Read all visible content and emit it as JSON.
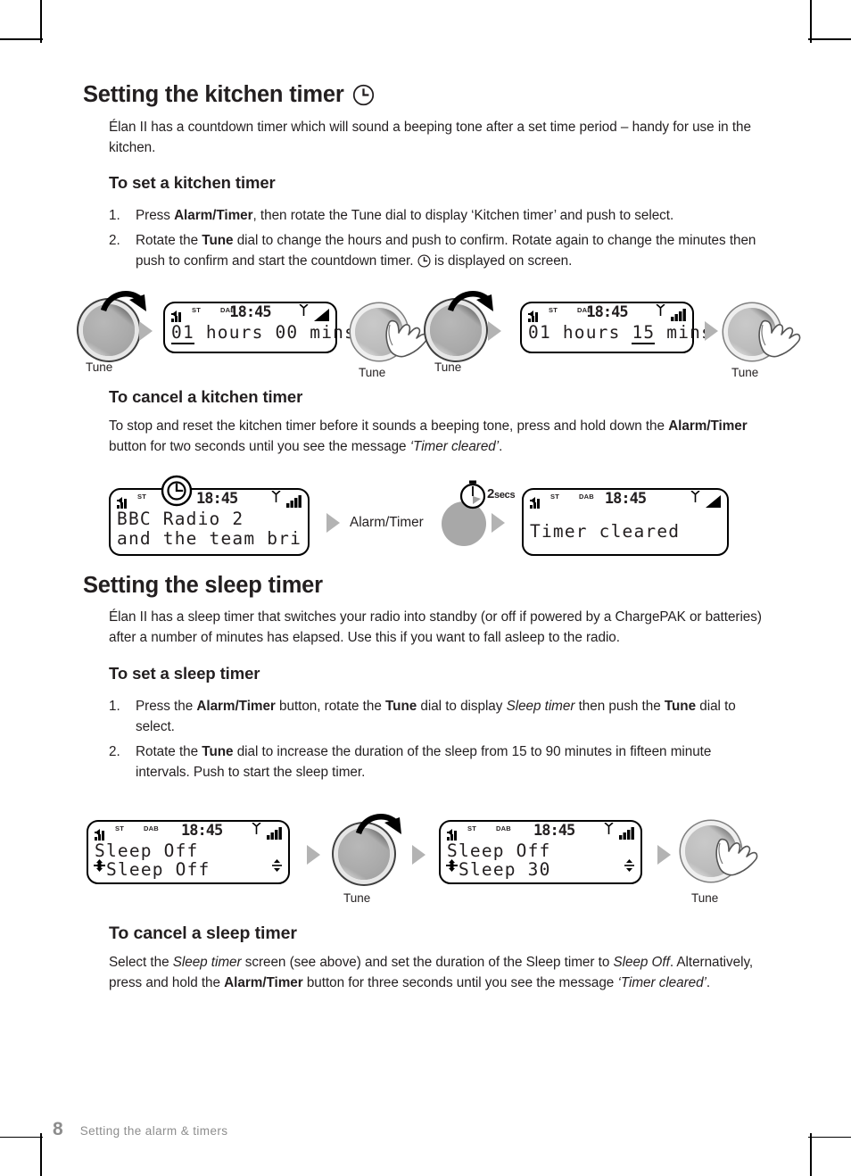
{
  "page": {
    "number": "8",
    "footer_title": "Setting the alarm & timers"
  },
  "sections": [
    {
      "id": "kitchen-timer",
      "heading": "Setting the kitchen timer",
      "heading_icon": "clock-icon",
      "intro": "Élan II has a countdown timer which will sound a beeping tone after a set time period – handy for use in the kitchen.",
      "sub_heading_set": "To set a kitchen timer",
      "steps": [
        {
          "num": "1.",
          "parts": [
            {
              "t": "Press ",
              "s": "n"
            },
            {
              "t": "Alarm/Timer",
              "s": "b"
            },
            {
              "t": ", then rotate the Tune dial to display ‘Kitchen timer’ and push to select.",
              "s": "n"
            }
          ]
        },
        {
          "num": "2.",
          "parts": [
            {
              "t": "Rotate the ",
              "s": "n"
            },
            {
              "t": "Tune",
              "s": "b"
            },
            {
              "t": " dial to change the hours and push to confirm. Rotate again to change the minutes then push to confirm and start the countdown timer. ",
              "s": "n"
            },
            {
              "t": "[clock]",
              "s": "icon"
            },
            {
              "t": " is displayed on screen.",
              "s": "n"
            }
          ]
        }
      ],
      "sub_heading_cancel": "To cancel a kitchen timer",
      "cancel_parts": [
        {
          "t": "To stop and reset the kitchen timer before it sounds a beeping tone, press and hold down the ",
          "s": "n"
        },
        {
          "t": "Alarm/Timer",
          "s": "b"
        },
        {
          "t": " button for two seconds until you see the message ",
          "s": "n"
        },
        {
          "t": "‘Timer cleared’",
          "s": "i"
        },
        {
          "t": ".",
          "s": "n"
        }
      ]
    },
    {
      "id": "sleep-timer",
      "heading": "Setting the sleep timer",
      "intro": "Élan II has a sleep timer that switches your radio into standby (or off if powered by a ChargePAK or batteries) after a number of minutes has elapsed. Use this if you want to fall asleep to the radio.",
      "sub_heading_set": "To set a sleep timer",
      "steps": [
        {
          "num": "1.",
          "parts": [
            {
              "t": "Press the ",
              "s": "n"
            },
            {
              "t": "Alarm/Timer",
              "s": "b"
            },
            {
              "t": " button, rotate the ",
              "s": "n"
            },
            {
              "t": "Tune",
              "s": "b"
            },
            {
              "t": " dial to display ",
              "s": "n"
            },
            {
              "t": "Sleep timer",
              "s": "i"
            },
            {
              "t": " then push the ",
              "s": "n"
            },
            {
              "t": "Tune",
              "s": "b"
            },
            {
              "t": " dial to select.",
              "s": "n"
            }
          ]
        },
        {
          "num": "2.",
          "parts": [
            {
              "t": "Rotate the ",
              "s": "n"
            },
            {
              "t": "Tune",
              "s": "b"
            },
            {
              "t": " dial to increase the duration of the sleep from 15 to 90 minutes in fifteen minute intervals. Push to start the sleep timer.",
              "s": "n"
            }
          ]
        }
      ],
      "sub_heading_cancel": "To cancel a sleep timer",
      "cancel_parts": [
        {
          "t": "Select the ",
          "s": "n"
        },
        {
          "t": "Sleep timer",
          "s": "i"
        },
        {
          "t": " screen (see above) and set the duration of the Sleep timer to ",
          "s": "n"
        },
        {
          "t": "Sleep Off",
          "s": "i"
        },
        {
          "t": ". Alternatively, press and hold the ",
          "s": "n"
        },
        {
          "t": "Alarm/Timer",
          "s": "b"
        },
        {
          "t": " button for three seconds until you see the message ",
          "s": "n"
        },
        {
          "t": "‘Timer cleared’",
          "s": "i"
        },
        {
          "t": ".",
          "s": "n"
        }
      ]
    }
  ],
  "displays": {
    "kitchen_1": {
      "status": {
        "st": "ST",
        "dab": "DAB",
        "time": "18:45"
      },
      "line1_pre": "",
      "line1_underlined": "01",
      "line1_post": " hours 00 mins"
    },
    "kitchen_2": {
      "status": {
        "st": "ST",
        "dab": "DAB",
        "time": "18:45"
      },
      "line1_pre": "01 hours ",
      "line1_underlined": "15",
      "line1_post": " mins"
    },
    "radio": {
      "status": {
        "st": "ST",
        "dab": "",
        "time": "18:45"
      },
      "line1": "BBC Radio 2",
      "line2": "and the team bri"
    },
    "cleared": {
      "status": {
        "st": "ST",
        "dab": "DAB",
        "time": "18:45"
      },
      "line1": "Timer cleared"
    },
    "sleep_1": {
      "status": {
        "st": "ST",
        "dab": "DAB",
        "time": "18:45"
      },
      "line1": "Sleep Off",
      "line2": "Sleep Off"
    },
    "sleep_2": {
      "status": {
        "st": "ST",
        "dab": "DAB",
        "time": "18:45"
      },
      "line1": "Sleep Off",
      "line2": "Sleep 30"
    }
  },
  "controls": {
    "tune_label": "Tune",
    "alarm_timer_label": "Alarm/Timer",
    "hold_duration": "2",
    "hold_unit": "secs"
  },
  "colors": {
    "text": "#231f20",
    "footer": "#8d8d8d",
    "arrow": "#b3b3b3",
    "knob": "#bdbdbd"
  }
}
